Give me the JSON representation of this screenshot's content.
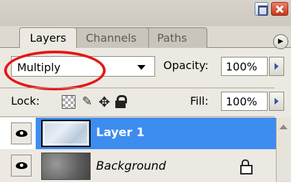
{
  "tabs": [
    {
      "label": "Layers",
      "active": true
    },
    {
      "label": "Channels",
      "active": false
    },
    {
      "label": "Paths",
      "active": false
    }
  ],
  "blend_mode": {
    "value": "Multiply"
  },
  "opacity": {
    "label": "Opacity:",
    "value": "100%"
  },
  "lock": {
    "label": "Lock:"
  },
  "fill": {
    "label": "Fill:",
    "value": "100%"
  },
  "layers": [
    {
      "name": "Layer 1",
      "selected": true,
      "visible": true
    },
    {
      "name": "Background",
      "selected": false,
      "visible": true,
      "locked": true
    }
  ],
  "colors": {
    "selection": "#3d8cf0",
    "highlight_ellipse": "#e31818"
  },
  "icons": [
    "minimize-icon",
    "close-icon",
    "panel-menu-icon",
    "lock-transparent-icon",
    "lock-image-icon",
    "lock-position-icon",
    "lock-all-icon",
    "eye-icon",
    "lock-icon"
  ]
}
